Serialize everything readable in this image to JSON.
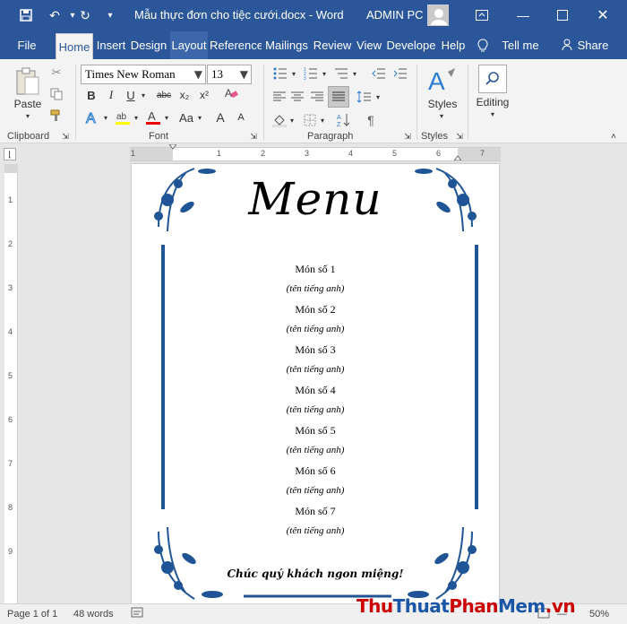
{
  "titlebar": {
    "title": "Mẫu thực đơn cho tiệc cưới.docx - Word",
    "user": "ADMIN PC"
  },
  "tabs": [
    "File",
    "Home",
    "Insert",
    "Design",
    "Layout",
    "Reference",
    "Mailings",
    "Review",
    "View",
    "Develope",
    "Help"
  ],
  "tell_me": "Tell me",
  "share": "Share",
  "ribbon": {
    "paste": "Paste",
    "font_name": "Times New Roman",
    "font_size": "13",
    "styles": "Styles",
    "editing": "Editing",
    "groups": {
      "clipboard": "Clipboard",
      "font": "Font",
      "paragraph": "Paragraph",
      "styles": "Styles"
    },
    "glyphs": {
      "bold": "B",
      "italic": "I",
      "underline": "U",
      "strike": "abc",
      "subscript": "x₂",
      "superscript": "x²",
      "case": "Aa",
      "grow": "A",
      "shrink": "A"
    }
  },
  "ruler": {
    "h_marks": [
      "1",
      "1",
      "2",
      "3",
      "4",
      "5",
      "6",
      "7"
    ],
    "v_marks": [
      "1",
      "2",
      "3",
      "4",
      "5",
      "6",
      "7",
      "8",
      "9"
    ]
  },
  "document": {
    "title": "Menu",
    "items": [
      {
        "name": "Món số 1",
        "en": "(tên tiếng anh)"
      },
      {
        "name": "Món số 2",
        "en": "(tên tiếng anh)"
      },
      {
        "name": "Món số 3",
        "en": "(tên tiếng anh)"
      },
      {
        "name": "Món số 4",
        "en": "(tên tiếng anh)"
      },
      {
        "name": "Món số 5",
        "en": "(tên tiếng anh)"
      },
      {
        "name": "Món số 6",
        "en": "(tên tiếng anh)"
      },
      {
        "name": "Món số 7",
        "en": "(tên tiếng anh)"
      }
    ],
    "closing": "Chúc quý khách ngon miệng!"
  },
  "status": {
    "page": "Page 1 of 1",
    "words": "48 words",
    "zoom": "50%"
  },
  "watermark": {
    "part1": "Thu",
    "part2": "Thuat",
    "part3": "Phan",
    "part4": "Mem",
    "part5": ".vn"
  },
  "colors": {
    "brand": "#2b579a",
    "border_ornament": "#1f5596"
  }
}
